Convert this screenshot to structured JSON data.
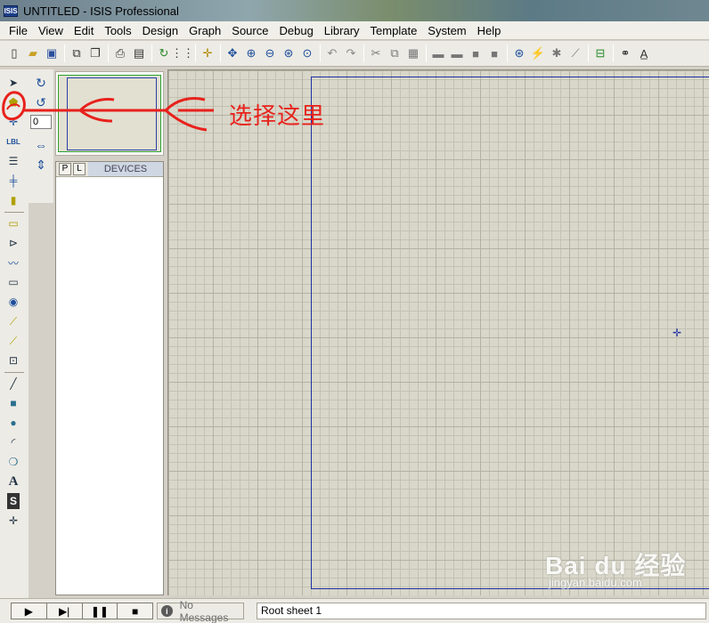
{
  "app": {
    "icon_text": "ISIS",
    "title": "UNTITLED - ISIS Professional"
  },
  "menu": [
    "File",
    "View",
    "Edit",
    "Tools",
    "Design",
    "Graph",
    "Source",
    "Debug",
    "Library",
    "Template",
    "System",
    "Help"
  ],
  "toolbar_icons": [
    "new-icon",
    "open-icon",
    "save-icon",
    "sep",
    "import-icon",
    "export-icon",
    "sep",
    "print-icon",
    "page-icon",
    "sep",
    "refresh-icon",
    "grid-icon",
    "sep",
    "origin-icon",
    "sep",
    "pan-icon",
    "zoom-in-icon",
    "zoom-out-icon",
    "zoom-all-icon",
    "zoom-area-icon",
    "sep",
    "undo-icon",
    "redo-icon",
    "sep",
    "cut-icon",
    "copy-icon",
    "paste-icon",
    "sep",
    "block-copy-icon",
    "block-move-icon",
    "block-rotate-icon",
    "block-delete-icon",
    "sep",
    "pick-device-icon",
    "make-device-icon",
    "decompose-icon",
    "packaging-icon",
    "sep",
    "wire-autorouter-icon",
    "sep",
    "search-icon",
    "property-icon"
  ],
  "orientation": {
    "angle_value": "0"
  },
  "device_panel": {
    "p_label": "P",
    "l_label": "L",
    "header": "DEVICES"
  },
  "annotation": {
    "text": "选择这里",
    "color": "#e8211c"
  },
  "status": {
    "messages": "No Messages",
    "sheet": "Root sheet 1"
  },
  "watermark": {
    "brand": "Bai du 经验",
    "sub": "jingyan.baidu.com"
  },
  "colors": {
    "canvas": "#d8d7c9",
    "sheet_border": "#1e2fa8"
  }
}
